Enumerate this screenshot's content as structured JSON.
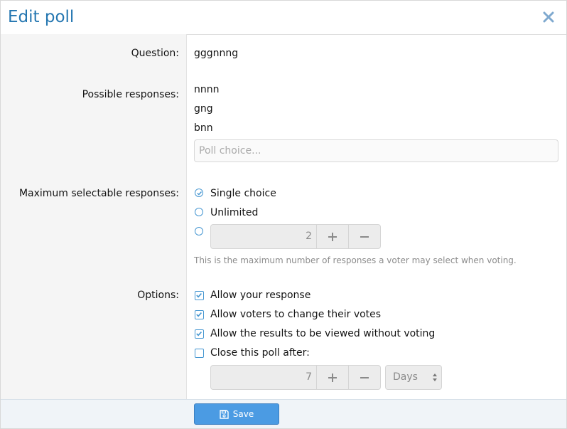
{
  "dialog": {
    "title": "Edit poll"
  },
  "labels": {
    "question": "Question:",
    "possible_responses": "Possible responses:",
    "max_selectable": "Maximum selectable responses:",
    "options": "Options:"
  },
  "question": {
    "value": "gggnnng"
  },
  "responses": [
    "nnnn",
    "gng",
    "bnn"
  ],
  "poll_choice": {
    "placeholder": "Poll choice..."
  },
  "max_responses": {
    "selected": "single",
    "single_label": "Single choice",
    "unlimited_label": "Unlimited",
    "custom_value": "2",
    "hint": "This is the maximum number of responses a voter may select when voting."
  },
  "options": {
    "allow_own_response": {
      "label": "Allow your response",
      "checked": true
    },
    "allow_change_votes": {
      "label": "Allow voters to change their votes",
      "checked": true
    },
    "view_without_voting": {
      "label": "Allow the results to be viewed without voting",
      "checked": true
    },
    "close_after": {
      "label": "Close this poll after:",
      "checked": false,
      "value": "7",
      "unit": "Days"
    }
  },
  "footer": {
    "save_label": "Save"
  },
  "colors": {
    "title": "#2577b1",
    "accent": "#4596d1",
    "save_button": "#4b9be3"
  }
}
